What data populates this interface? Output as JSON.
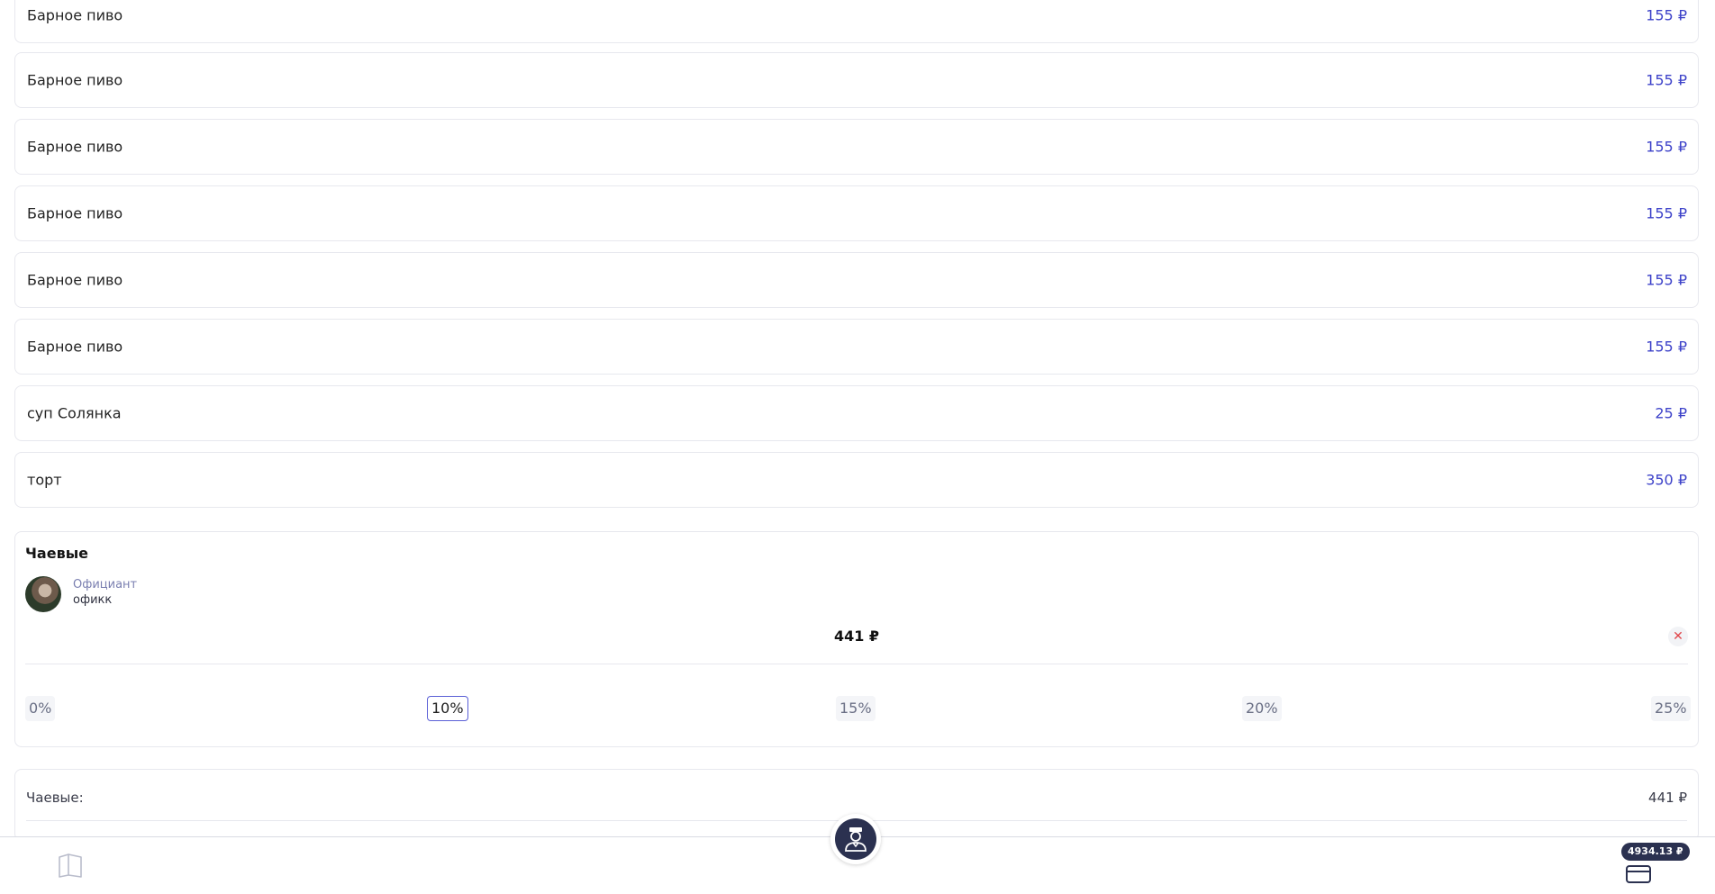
{
  "order": {
    "items": [
      {
        "name": "Барное пиво",
        "price": "155 ₽"
      },
      {
        "name": "Барное пиво",
        "price": "155 ₽"
      },
      {
        "name": "Барное пиво",
        "price": "155 ₽"
      },
      {
        "name": "Барное пиво",
        "price": "155 ₽"
      },
      {
        "name": "Барное пиво",
        "price": "155 ₽"
      },
      {
        "name": "Барное пиво",
        "price": "155 ₽"
      },
      {
        "name": "суп Солянка",
        "price": "25 ₽"
      },
      {
        "name": "торт",
        "price": "350 ₽"
      }
    ]
  },
  "tips": {
    "title": "Чаевые",
    "waiter_role": "Официант",
    "waiter_name": "офикк",
    "amount": "441 ₽",
    "options": [
      "0%",
      "10%",
      "15%",
      "20%",
      "25%"
    ],
    "selected": "10%"
  },
  "summary": {
    "tips_label": "Чаевые:",
    "tips_value": "441 ₽"
  },
  "bottom_bar": {
    "total_badge": "4934.13 ₽",
    "icons": [
      "menu-book-icon",
      "waiter-icon",
      "card-icon"
    ]
  },
  "colors": {
    "accent": "#3d42c9",
    "dark": "#2b3150",
    "border": "#e7e8ee",
    "danger": "#e0454a"
  }
}
